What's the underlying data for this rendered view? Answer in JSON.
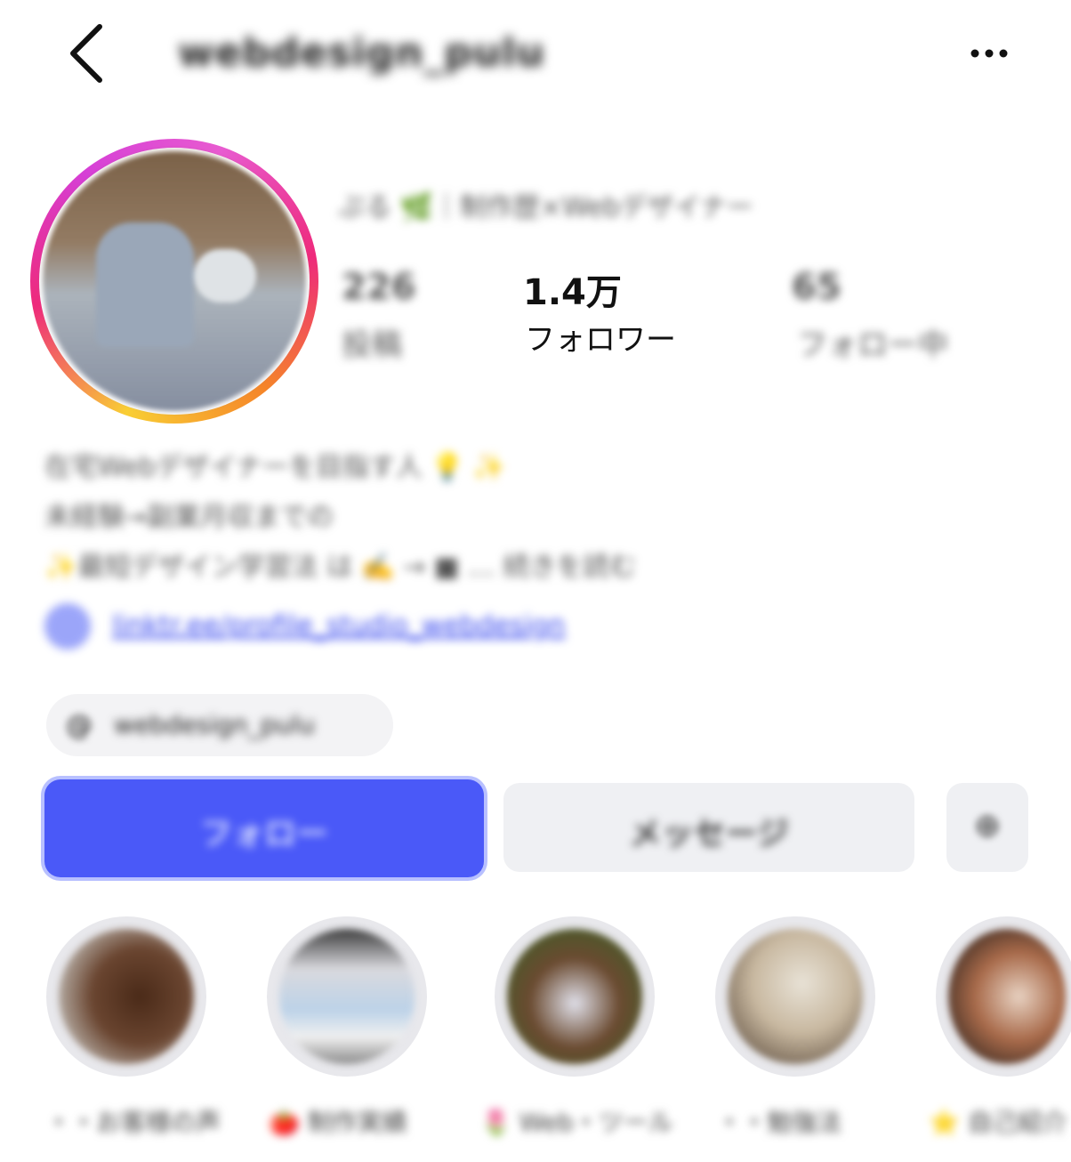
{
  "header": {
    "back_icon": "chevron-left-icon",
    "username": "webdesign_pulu",
    "more_icon": "more-horizontal-icon"
  },
  "profile": {
    "display_name": "ぷる 🌿｜制作歴×Webデザイナー",
    "stats": {
      "posts_count": "226",
      "posts_label": "投稿",
      "followers_count": "1.4万",
      "followers_label": "フォロワー",
      "following_count": "65",
      "following_label": "フォロー中"
    },
    "bio": [
      "在宅Webデザイナーを目指す人 💡 ✨",
      "未経験→副業月収までの",
      "✨最短デザイン学習法 は ✍️ → ■ … 続きを読む"
    ],
    "link": "linktr.ee/profile_studio_webdesign",
    "threads_handle": "webdesign_pulu"
  },
  "actions": {
    "follow_label": "フォロー",
    "message_label": "メッセージ",
    "suggest_icon": "add-person-icon"
  },
  "highlights": [
    {
      "label": "・・お客様の声"
    },
    {
      "label": "🍅 制作実績"
    },
    {
      "label": "🌷 Web・ツール"
    },
    {
      "label": "・・勉強法"
    },
    {
      "label": "⭐ 自己紹介"
    }
  ],
  "colors": {
    "follow_button": "#4a59f8",
    "secondary_button": "#eff0f3",
    "link": "#3344ee",
    "story_ring": "#ee2a7b"
  }
}
